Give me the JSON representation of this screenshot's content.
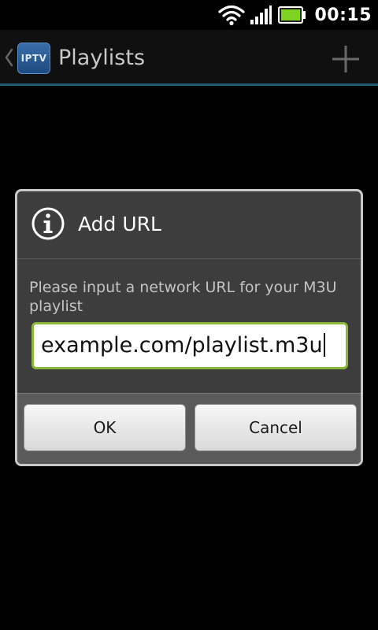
{
  "status_bar": {
    "time": "00:15",
    "icons": [
      "wifi-icon",
      "signal-icon",
      "battery-icon"
    ],
    "battery_color": "#7ed321"
  },
  "action_bar": {
    "logo_text": "IPTV",
    "title": "Playlists",
    "icons": [
      "back-chevron-icon",
      "add-icon"
    ],
    "accent_color": "#1f5c6e"
  },
  "dialog": {
    "icon": "info-icon",
    "title": "Add URL",
    "message": "Please input a network URL for your M3U playlist",
    "input_value": "example.com/playlist.m3u",
    "input_border_color": "#8ab93a",
    "ok_label": "OK",
    "cancel_label": "Cancel"
  }
}
